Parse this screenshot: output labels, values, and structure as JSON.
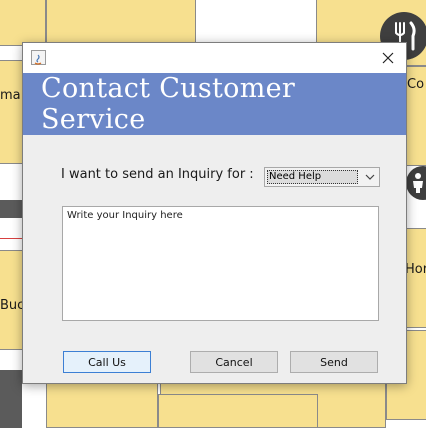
{
  "background": {
    "partial_labels": [
      "ma",
      "Co",
      "Hor",
      "Buc"
    ],
    "icons": [
      "fork-knife-icon",
      "person-icon"
    ]
  },
  "dialog": {
    "banner_title": "Contact Customer Service",
    "inquiry_label": "I want to send an Inquiry for :",
    "inquiry_type": {
      "selected": "Need Help"
    },
    "message": {
      "placeholder": "Write your Inquiry here"
    },
    "buttons": {
      "call_us": "Call Us",
      "cancel": "Cancel",
      "send": "Send"
    }
  },
  "colors": {
    "banner": "#6b87c8",
    "tile": "#f7e08f",
    "focus_border": "#3c7fd4"
  }
}
